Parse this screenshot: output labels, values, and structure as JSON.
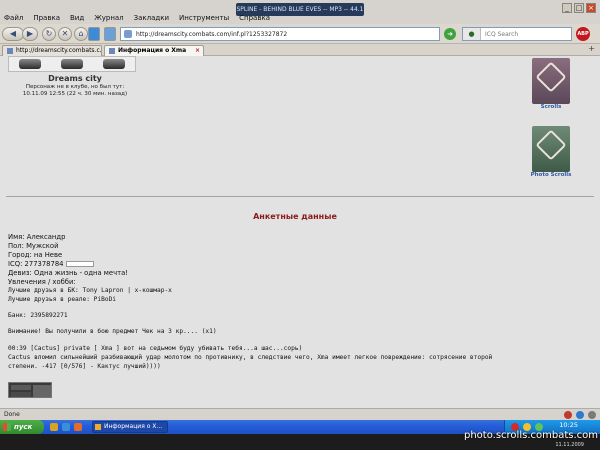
{
  "window": {
    "music_title": "SPLINE - BEHIND BLUE EVES -- MP3 -- 44.1"
  },
  "menubar": [
    "Файл",
    "Правка",
    "Вид",
    "Журнал",
    "Закладки",
    "Инструменты",
    "Справка"
  ],
  "navbar": {
    "url": "http://dreamscity.combats.com/inf.pl?1253327872",
    "search_placeholder": "ICQ Search"
  },
  "tabs": [
    {
      "label": "http://dreamscity.combats.c..."
    },
    {
      "label": "Информация о Xma"
    }
  ],
  "character": {
    "city": "Dreams city",
    "status_line1": "Персонаж не в клубе, но был тут:",
    "status_line2": "10.11.09 12:55 (22 ч. 30 мин. назад)"
  },
  "banners": {
    "scrolls_label": "Scrolls",
    "photo_label": "Photo Scrolls"
  },
  "profile": {
    "title": "Анкетные данные",
    "name": "Имя: Александр",
    "gender": "Пол: Мужской",
    "city": "Город: на Неве",
    "icq": "ICQ: 277378784",
    "motto": "Девиз: Одна жизнь - одна мечта!",
    "hobbies": "Увлечения / хобби:",
    "friends_bk": "Лучшие друзья в БК: Tony Lapron  |  х-кошмар-х",
    "friends_real": "Лучшие друзья в реале: PiBoDi",
    "bank": "Банк: 2395892271",
    "notice": "Внимание! Вы получили в бою предмет Чек на 3 кр....   (x1)",
    "log1": "00:39 [Cactus] private [ Xma ] вот на седьмом буду убивать тебя...а шас...сорь)",
    "log2": "Cactus вломил сильнейший разбивающий удар молотом по противнику, в следствие чего, Xma имеет легкое повреждение: сотрясение второй",
    "log3": "степени. -417 [0/576] - Кактус лучший))))"
  },
  "statusbar": {
    "text": "Done"
  },
  "taskbar": {
    "start": "пуск",
    "task_label": "Информация о Х...",
    "clock": "10:25"
  },
  "watermark": {
    "text": "photo.scrolls.combats.com",
    "date": "11.11.2009"
  }
}
